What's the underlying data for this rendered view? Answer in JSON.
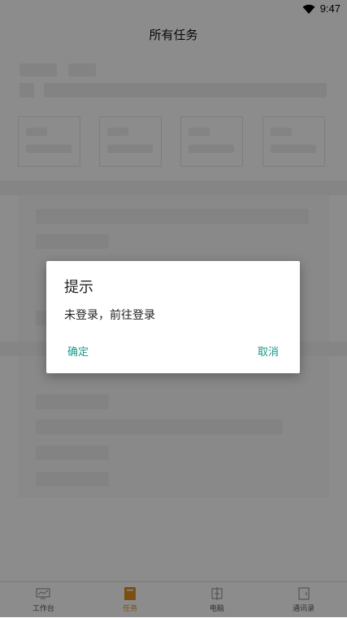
{
  "status_bar": {
    "time": "9:47",
    "wifi_icon": "wifi-icon"
  },
  "header": {
    "title": "所有任务"
  },
  "dialog": {
    "title": "提示",
    "message": "未登录，前往登录",
    "confirm_label": "确定",
    "cancel_label": "取消"
  },
  "bottom_nav": {
    "items": [
      {
        "label": "工作台",
        "icon": "monitor-icon",
        "active": false
      },
      {
        "label": "任务",
        "icon": "task-icon",
        "active": true
      },
      {
        "label": "电脑",
        "icon": "computer-icon",
        "active": false
      },
      {
        "label": "通讯录",
        "icon": "contacts-icon",
        "active": false
      }
    ]
  },
  "colors": {
    "accent": "#159a8a",
    "active_tab": "#e0911d",
    "overlay": "rgba(0,0,0,0.45)"
  }
}
